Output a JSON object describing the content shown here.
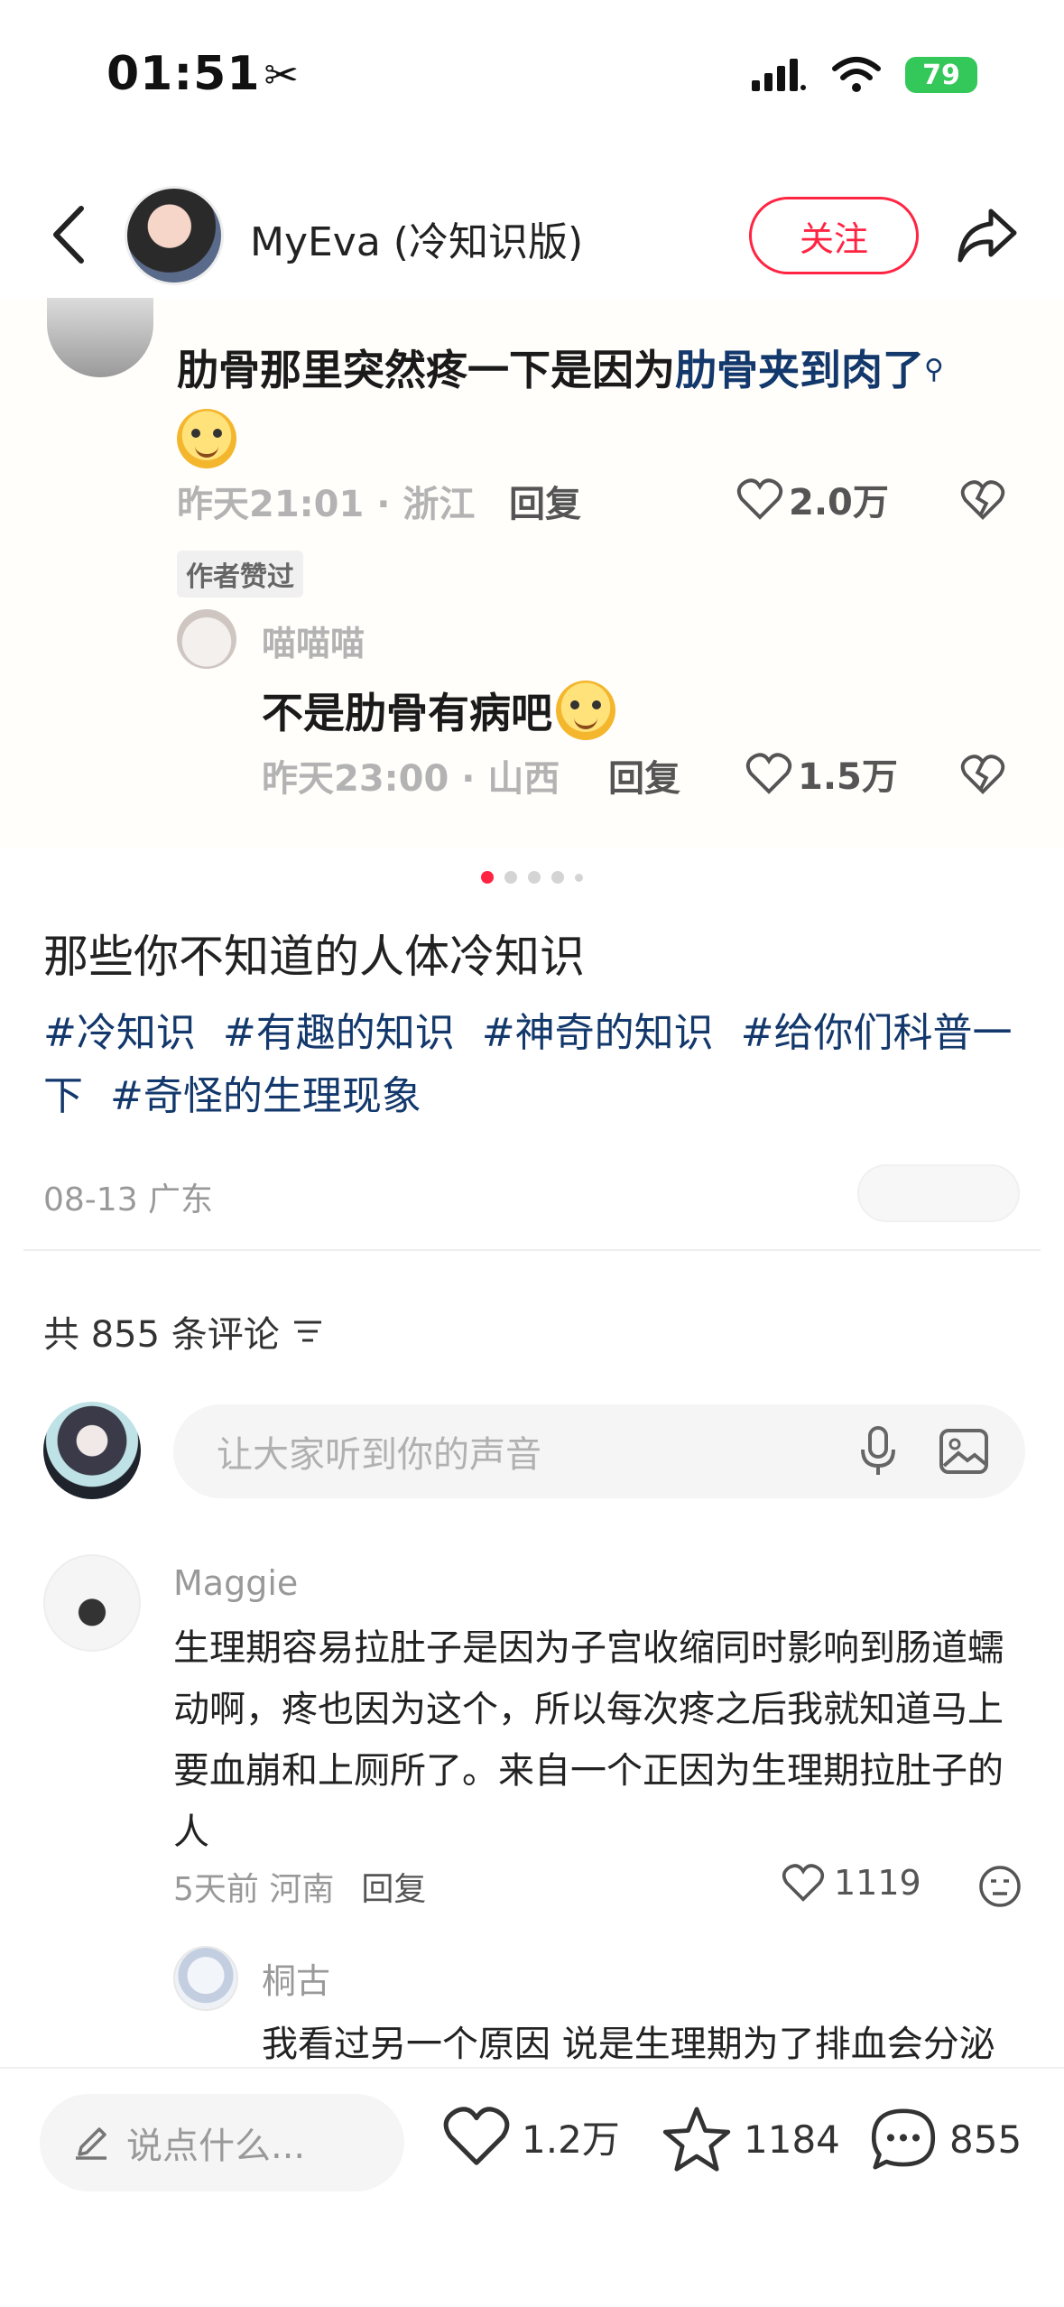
{
  "status_bar": {
    "time": "01:51",
    "battery": "79"
  },
  "header": {
    "author_name": "MyEva (冷知识版)",
    "follow_label": "关注"
  },
  "image_content": {
    "comment1_text_prefix": "肋骨那里突然疼一下是因为",
    "comment1_text_highlight": "肋骨夹到肉了",
    "comment1_time_location": "昨天21:01 · 浙江",
    "comment1_reply_label": "回复",
    "comment1_likes": "2.0万",
    "author_liked_badge": "作者赞过",
    "reply1_name": "喵喵喵",
    "reply1_text": "不是肋骨有病吧",
    "reply1_time_location": "昨天23:00 · 山西",
    "reply1_reply_label": "回复",
    "reply1_likes": "1.5万"
  },
  "carousel": {
    "total": 5,
    "active_index": 0
  },
  "post": {
    "title": "那些你不知道的人体冷知识",
    "tags": [
      "#冷知识",
      "#有趣的知识",
      "#神奇的知识",
      "#给你们科普一下",
      "#奇怪的生理现象"
    ],
    "date_location": "08-13 广东"
  },
  "comments": {
    "count_label": "共 855 条评论",
    "input_placeholder": "让大家听到你的声音",
    "items": [
      {
        "name": "Maggie",
        "text": "生理期容易拉肚子是因为子宫收缩同时影响到肠道蠕动啊，疼也因为这个，所以每次疼之后我就知道马上要血崩和上厕所了。来自一个正因为生理期拉肚子的人",
        "time": "5天前",
        "location": "河南",
        "reply_label": "回复",
        "likes": "1119",
        "replies": [
          {
            "name": "桐古",
            "text": "我看过另一个原因 说是生理期为了排血会分泌"
          }
        ]
      }
    ]
  },
  "bottom_bar": {
    "input_placeholder": "说点什么...",
    "likes": "1.2万",
    "collects": "1184",
    "comments": "855"
  }
}
